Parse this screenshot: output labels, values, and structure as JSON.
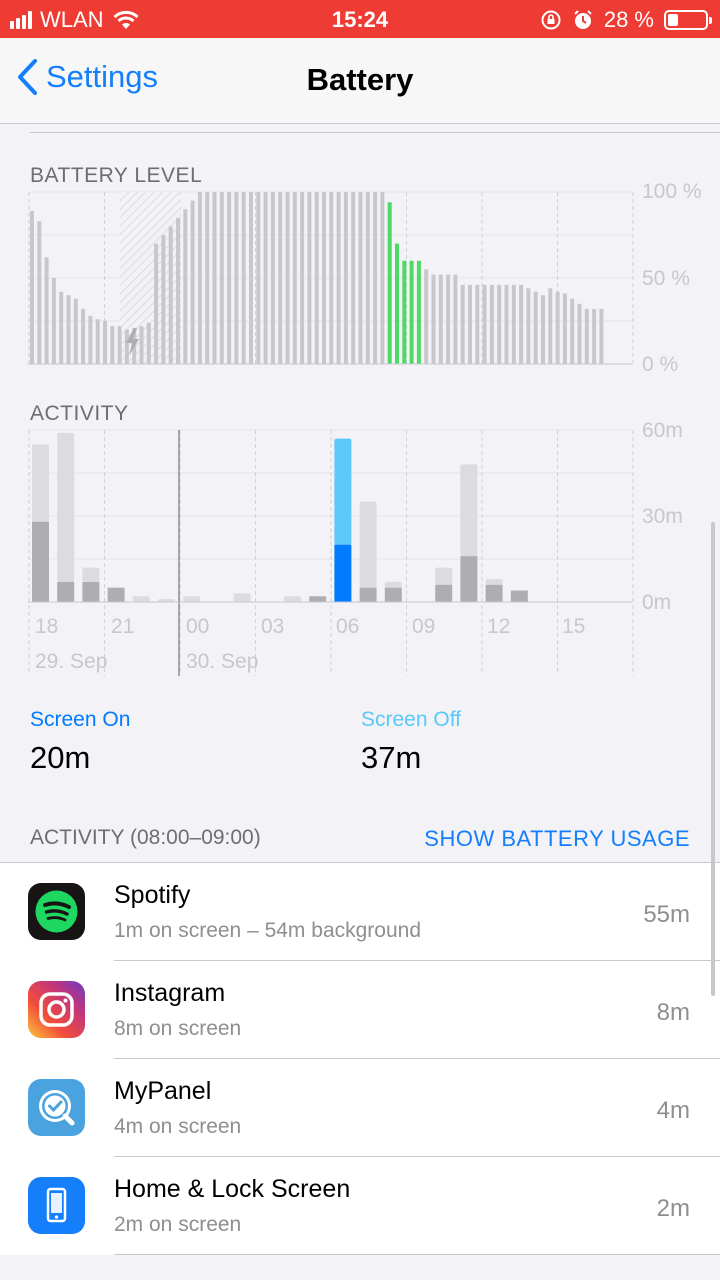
{
  "status_bar": {
    "carrier": "WLAN",
    "time": "15:24",
    "battery_percent": "28 %",
    "battery_level": 0.28
  },
  "nav": {
    "back_label": "Settings",
    "title": "Battery"
  },
  "battery_level_chart": {
    "label": "BATTERY LEVEL",
    "y_ticks": [
      "100 %",
      "50 %",
      "0 %"
    ],
    "colors": {
      "normal": "#c7c7cc",
      "active": "#4cd964"
    },
    "bars": [
      {
        "v": 89,
        "c": 0
      },
      {
        "v": 83,
        "c": 0
      },
      {
        "v": 62,
        "c": 0
      },
      {
        "v": 50,
        "c": 0
      },
      {
        "v": 42,
        "c": 0
      },
      {
        "v": 40,
        "c": 0
      },
      {
        "v": 38,
        "c": 0
      },
      {
        "v": 32,
        "c": 0
      },
      {
        "v": 28,
        "c": 0
      },
      {
        "v": 26,
        "c": 0
      },
      {
        "v": 25,
        "c": 0
      },
      {
        "v": 22,
        "c": 0
      },
      {
        "v": 22,
        "c": 0
      },
      {
        "v": 20,
        "c": 0
      },
      {
        "v": 21,
        "c": 0
      },
      {
        "v": 22,
        "c": 0
      },
      {
        "v": 24,
        "c": 0
      },
      {
        "v": 70,
        "c": 0
      },
      {
        "v": 75,
        "c": 0
      },
      {
        "v": 80,
        "c": 0
      },
      {
        "v": 85,
        "c": 0
      },
      {
        "v": 90,
        "c": 0
      },
      {
        "v": 95,
        "c": 0
      },
      {
        "v": 100,
        "c": 0
      },
      {
        "v": 100,
        "c": 0
      },
      {
        "v": 100,
        "c": 0
      },
      {
        "v": 100,
        "c": 0
      },
      {
        "v": 100,
        "c": 0
      },
      {
        "v": 100,
        "c": 0
      },
      {
        "v": 100,
        "c": 0
      },
      {
        "v": 100,
        "c": 0
      },
      {
        "v": 100,
        "c": 0
      },
      {
        "v": 100,
        "c": 0
      },
      {
        "v": 100,
        "c": 0
      },
      {
        "v": 100,
        "c": 0
      },
      {
        "v": 100,
        "c": 0
      },
      {
        "v": 100,
        "c": 0
      },
      {
        "v": 100,
        "c": 0
      },
      {
        "v": 100,
        "c": 0
      },
      {
        "v": 100,
        "c": 0
      },
      {
        "v": 100,
        "c": 0
      },
      {
        "v": 100,
        "c": 0
      },
      {
        "v": 100,
        "c": 0
      },
      {
        "v": 100,
        "c": 0
      },
      {
        "v": 100,
        "c": 0
      },
      {
        "v": 100,
        "c": 0
      },
      {
        "v": 100,
        "c": 0
      },
      {
        "v": 100,
        "c": 0
      },
      {
        "v": 100,
        "c": 0
      },
      {
        "v": 94,
        "c": 1
      },
      {
        "v": 70,
        "c": 1
      },
      {
        "v": 60,
        "c": 1
      },
      {
        "v": 60,
        "c": 1
      },
      {
        "v": 60,
        "c": 1
      },
      {
        "v": 55,
        "c": 0
      },
      {
        "v": 52,
        "c": 0
      },
      {
        "v": 52,
        "c": 0
      },
      {
        "v": 52,
        "c": 0
      },
      {
        "v": 52,
        "c": 0
      },
      {
        "v": 46,
        "c": 0
      },
      {
        "v": 46,
        "c": 0
      },
      {
        "v": 46,
        "c": 0
      },
      {
        "v": 46,
        "c": 0
      },
      {
        "v": 46,
        "c": 0
      },
      {
        "v": 46,
        "c": 0
      },
      {
        "v": 46,
        "c": 0
      },
      {
        "v": 46,
        "c": 0
      },
      {
        "v": 46,
        "c": 0
      },
      {
        "v": 44,
        "c": 0
      },
      {
        "v": 42,
        "c": 0
      },
      {
        "v": 40,
        "c": 0
      },
      {
        "v": 44,
        "c": 0
      },
      {
        "v": 42,
        "c": 0
      },
      {
        "v": 41,
        "c": 0
      },
      {
        "v": 38,
        "c": 0
      },
      {
        "v": 35,
        "c": 0
      },
      {
        "v": 32,
        "c": 0
      },
      {
        "v": 32,
        "c": 0
      },
      {
        "v": 32,
        "c": 0
      }
    ]
  },
  "activity_chart": {
    "label": "ACTIVITY",
    "y_ticks": [
      "60m",
      "30m",
      "0m"
    ],
    "x_ticks": [
      "18",
      "21",
      "00",
      "03",
      "06",
      "09",
      "12",
      "15"
    ],
    "dates": [
      "29. Sep",
      "30. Sep"
    ],
    "colors": {
      "screen_on": "#007aff",
      "screen_off": "#5ac8fa",
      "on_gray": "#aeaeb2",
      "off_gray": "#dcdcdf"
    },
    "bars": [
      {
        "on": 28,
        "off": 27,
        "hi": 0
      },
      {
        "on": 7,
        "off": 52,
        "hi": 0
      },
      {
        "on": 7,
        "off": 5,
        "hi": 0
      },
      {
        "on": 5,
        "off": 0,
        "hi": 0
      },
      {
        "on": 0,
        "off": 2,
        "hi": 0
      },
      {
        "on": 0,
        "off": 1,
        "hi": 0
      },
      {
        "on": 0,
        "off": 2,
        "hi": 0
      },
      {
        "on": 0,
        "off": 0,
        "hi": 0
      },
      {
        "on": 0,
        "off": 3,
        "hi": 0
      },
      {
        "on": 0,
        "off": 0,
        "hi": 0
      },
      {
        "on": 0,
        "off": 2,
        "hi": 0
      },
      {
        "on": 2,
        "off": 0,
        "hi": 0
      },
      {
        "on": 20,
        "off": 37,
        "hi": 1
      },
      {
        "on": 5,
        "off": 30,
        "hi": 0
      },
      {
        "on": 5,
        "off": 2,
        "hi": 0
      },
      {
        "on": 0,
        "off": 0,
        "hi": 0
      },
      {
        "on": 6,
        "off": 6,
        "hi": 0
      },
      {
        "on": 16,
        "off": 32,
        "hi": 0
      },
      {
        "on": 6,
        "off": 2,
        "hi": 0
      },
      {
        "on": 4,
        "off": 0,
        "hi": 0
      }
    ]
  },
  "screen_on": {
    "label": "Screen On",
    "value": "20m"
  },
  "screen_off": {
    "label": "Screen Off",
    "value": "37m"
  },
  "activity_section": {
    "header": "ACTIVITY (08:00–09:00)",
    "show_usage": "SHOW BATTERY USAGE",
    "apps": [
      {
        "name": "Spotify",
        "detail": "1m on screen – 54m background",
        "time": "55m",
        "icon": "spotify-icon"
      },
      {
        "name": "Instagram",
        "detail": "8m on screen",
        "time": "8m",
        "icon": "instagram-icon"
      },
      {
        "name": "MyPanel",
        "detail": "4m on screen",
        "time": "4m",
        "icon": "mypanel-icon"
      },
      {
        "name": "Home & Lock Screen",
        "detail": "2m on screen",
        "time": "2m",
        "icon": "home-lock-icon"
      }
    ]
  }
}
